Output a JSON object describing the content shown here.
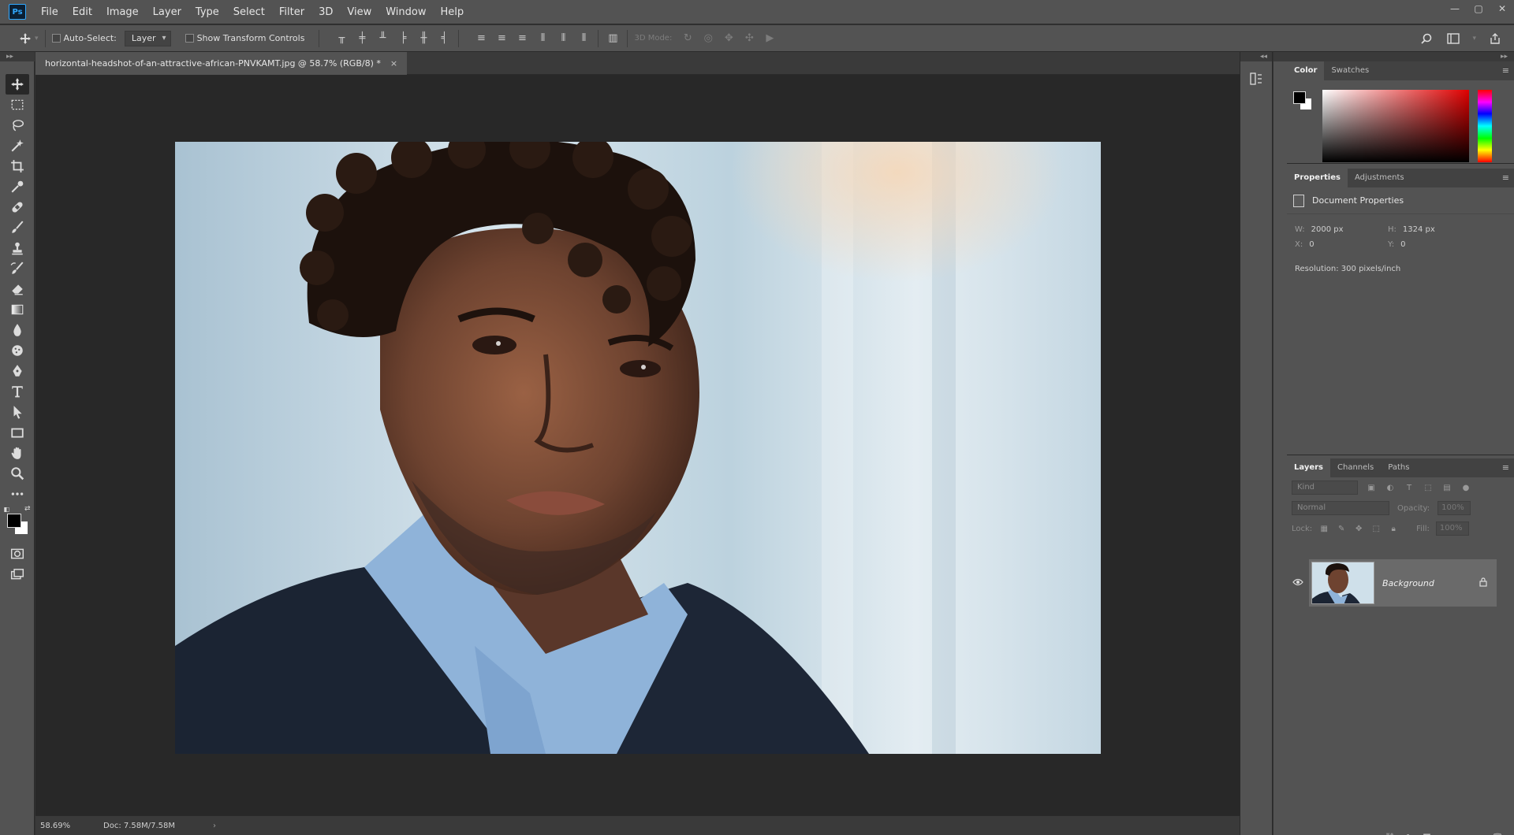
{
  "app": {
    "logo": "Ps"
  },
  "menu": [
    "File",
    "Edit",
    "Image",
    "Layer",
    "Type",
    "Select",
    "Filter",
    "3D",
    "View",
    "Window",
    "Help"
  ],
  "window_controls": [
    "—",
    "▢",
    "✕"
  ],
  "options": {
    "auto_select_label": "Auto-Select:",
    "auto_select_target": "Layer",
    "show_transform_label": "Show Transform Controls",
    "mode_3d_label": "3D Mode:"
  },
  "document": {
    "tab_title": "horizontal-headshot-of-an-attractive-african-PNVKAMT.jpg @ 58.7% (RGB/8) *",
    "close_glyph": "×"
  },
  "status": {
    "zoom": "58.69%",
    "doc_size": "Doc: 7.58M/7.58M",
    "arrow": "›"
  },
  "panels": {
    "color": {
      "tabs": [
        "Color",
        "Swatches"
      ],
      "foreground": "#000000",
      "background": "#ffffff",
      "hue": "#e00000"
    },
    "properties": {
      "tabs": [
        "Properties",
        "Adjustments"
      ],
      "title": "Document Properties",
      "w_label": "W:",
      "w_value": "2000 px",
      "h_label": "H:",
      "h_value": "1324 px",
      "x_label": "X:",
      "x_value": "0",
      "y_label": "Y:",
      "y_value": "0",
      "resolution": "Resolution: 300 pixels/inch"
    },
    "layers": {
      "tabs": [
        "Layers",
        "Channels",
        "Paths"
      ],
      "kind_placeholder": "Kind",
      "blend_mode": "Normal",
      "opacity_label": "Opacity:",
      "opacity_value": "100%",
      "lock_label": "Lock:",
      "fill_label": "Fill:",
      "fill_value": "100%",
      "layer_name": "Background"
    }
  },
  "colors": {
    "accent": "#31a8ff",
    "chrome": "#535353",
    "canvas_bg": "#282828"
  }
}
